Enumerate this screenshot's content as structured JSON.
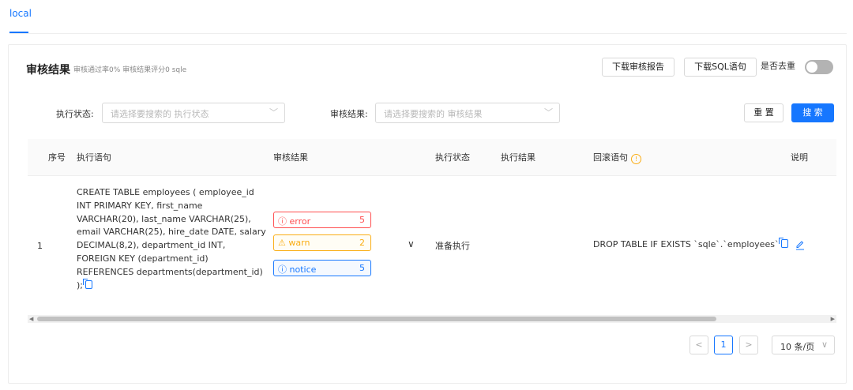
{
  "tabs": [
    {
      "label": "local"
    }
  ],
  "result": {
    "title": "审核结果",
    "subtitle": "审核通过率0%  审核结果评分0  sqle"
  },
  "toolbar": {
    "download_report": "下载审核报告",
    "download_sql": "下载SQL语句",
    "dedupe_label": "是否去重",
    "dedupe_on": false
  },
  "filters": {
    "exec_status_label": "执行状态:",
    "exec_status_placeholder": "请选择要搜索的 执行状态",
    "audit_result_label": "审核结果:",
    "audit_result_placeholder": "请选择要搜索的 审核结果",
    "reset": "重 置",
    "search": "搜 索"
  },
  "table": {
    "columns": [
      "序号",
      "执行语句",
      "审核结果",
      "执行状态",
      "执行结果",
      "回滚语句",
      "说明"
    ],
    "rows": [
      {
        "index": "1",
        "sql_lines": [
          "CREATE TABLE employees ( employee_id",
          "INT PRIMARY KEY, first_name",
          "VARCHAR(20), last_name VARCHAR(25),",
          "email VARCHAR(25), hire_date DATE, salary",
          "DECIMAL(8,2), department_id INT,",
          "FOREIGN KEY (department_id)",
          "REFERENCES departments(department_id)",
          ");"
        ],
        "audit": {
          "error_label": "error",
          "error_count": "5",
          "warn_label": "warn",
          "warn_count": "2",
          "notice_label": "notice",
          "notice_count": "5"
        },
        "exec_status": "准备执行",
        "exec_result": "",
        "rollback_sql": "DROP TABLE IF EXISTS `sqle`.`employees`",
        "note": ""
      }
    ]
  },
  "pagination": {
    "current": "1",
    "page_size": "10 条/页"
  },
  "colors": {
    "primary": "#1677ff",
    "error": "#ff4d4f",
    "warn": "#faad14"
  }
}
